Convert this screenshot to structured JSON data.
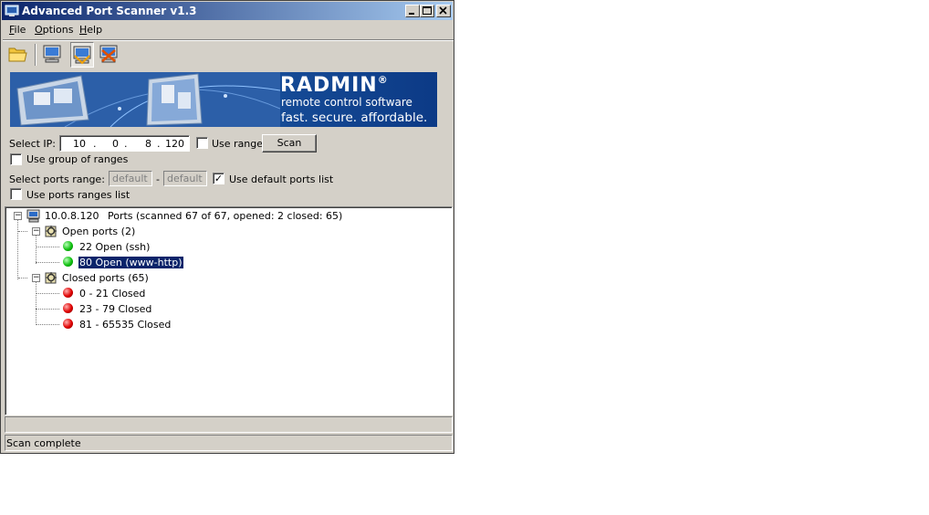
{
  "window": {
    "title": "Advanced Port Scanner v1.3"
  },
  "menu": {
    "file": "File",
    "options": "Options",
    "help": "Help"
  },
  "toolbar": {
    "icons": [
      "folder-icon",
      "computer-icon",
      "computer-scan-icon",
      "computer-stop-icon"
    ]
  },
  "banner": {
    "brand": "RADMIN",
    "registered": "®",
    "tagline1": "remote control software",
    "tagline2": "fast. secure. affordable."
  },
  "form": {
    "select_ip_label": "Select IP:",
    "ip": [
      "10",
      "0",
      "8",
      "120"
    ],
    "ip_dot": ".",
    "use_range_label": "Use range",
    "scan_button": "Scan",
    "use_group_label": "Use group of ranges",
    "select_ports_label": "Select ports range:",
    "port_from_placeholder": "default",
    "port_sep": "-",
    "port_to_placeholder": "default",
    "use_default_ports_label": "Use default ports list",
    "use_default_ports_checked": true,
    "use_ports_ranges_label": "Use ports ranges list",
    "use_range_checked": false,
    "use_group_checked": false,
    "use_ports_ranges_checked": false
  },
  "tree": {
    "host": "10.0.8.120",
    "host_summary": "Ports (scanned 67 of 67, opened: 2 closed: 65)",
    "open_group": "Open ports (2)",
    "open_items": [
      "22 Open (ssh)",
      "80 Open (www-http)"
    ],
    "closed_group": "Closed ports (65)",
    "closed_items": [
      "0 - 21 Closed",
      "23 - 79 Closed",
      "81 - 65535 Closed"
    ],
    "expanded_symbol": "−"
  },
  "status": {
    "text": "Scan complete"
  },
  "colors": {
    "title_start": "#0a246a",
    "title_end": "#a6caf0",
    "open": "#10c010",
    "closed": "#e00000",
    "selection": "#0a246a"
  }
}
